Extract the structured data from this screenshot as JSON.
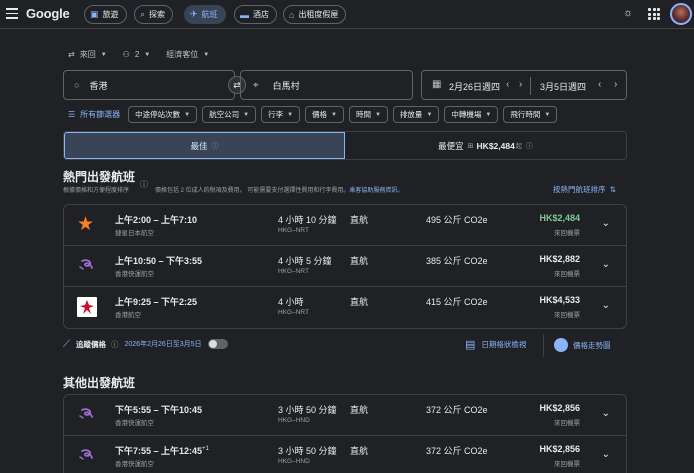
{
  "topbar": {
    "logo": "Google",
    "nav": [
      {
        "label": "旅遊",
        "icon": "travel-icon"
      },
      {
        "label": "探索",
        "icon": "explore-icon"
      },
      {
        "label": "航班",
        "icon": "flight-icon",
        "active": true
      },
      {
        "label": "酒店",
        "icon": "hotel-icon"
      },
      {
        "label": "出租度假屋",
        "icon": "vacation-rental-icon"
      }
    ]
  },
  "search": {
    "trip_type": "來回",
    "passengers": "2",
    "cabin": "經濟客位",
    "origin": "香港",
    "destination": "白馬村",
    "depart_date": "2月26日週四",
    "return_date": "3月5日週四"
  },
  "filters": {
    "all_label": "所有篩選器",
    "chips": [
      "中途停站次數",
      "航空公司",
      "行李",
      "價格",
      "時間",
      "排放量",
      "中轉機場",
      "飛行時間"
    ]
  },
  "sort_tabs": {
    "best": "最佳",
    "cheapest": "最便宜",
    "cheapest_price": "HK$2,484",
    "cheapest_suffix": "起"
  },
  "top_flights": {
    "title": "熱門出發航班",
    "subtitle_left": "根據價格和方便程度排序",
    "subtitle_right": "價格包括 2 位成人的稅項及費用。 可能需要支付選擇性費用和行李費用。",
    "subtitle_link": "乘客協助服務資訊。",
    "sort_label": "按熱門航班排序",
    "rows": [
      {
        "times": "上午2:00 – 上午7:10",
        "sup": "",
        "airline": "捷星日本航空",
        "duration": "4 小時 10 分鐘",
        "route": "HKG–NRT",
        "stops": "直航",
        "co2": "495 公斤 CO2e",
        "price": "HK$2,484",
        "price_type": "來回機票",
        "logo": "jetstar",
        "green": true
      },
      {
        "times": "上午10:50 – 下午3:55",
        "sup": "",
        "airline": "香港快運航空",
        "duration": "4 小時 5 分鐘",
        "route": "HKG–NRT",
        "stops": "直航",
        "co2": "385 公斤 CO2e",
        "price": "HK$2,882",
        "price_type": "來回機票",
        "logo": "hkexpress",
        "green": false
      },
      {
        "times": "上午9:25 – 下午2:25",
        "sup": "",
        "airline": "香港航空",
        "duration": "4 小時",
        "route": "HKG–NRT",
        "stops": "直航",
        "co2": "415 公斤 CO2e",
        "price": "HK$4,533",
        "price_type": "來回機票",
        "logo": "hkairlines",
        "green": false
      }
    ]
  },
  "tracking": {
    "label": "追蹤價格",
    "dates": "2026年2月26日至3月5日",
    "date_grid": "日期格狀檢視",
    "price_graph": "價格走勢圖"
  },
  "other_flights": {
    "title": "其他出發航班",
    "rows": [
      {
        "times": "下午5:55 – 下午10:45",
        "sup": "",
        "airline": "香港快運航空",
        "duration": "3 小時 50 分鐘",
        "route": "HKG–HND",
        "stops": "直航",
        "co2": "372 公斤 CO2e",
        "price": "HK$2,856",
        "price_type": "來回機票",
        "logo": "hkexpress",
        "green": false
      },
      {
        "times": "下午7:55 – 上午12:45",
        "sup": "+1",
        "airline": "香港快運航空",
        "duration": "3 小時 50 分鐘",
        "route": "HKG–HND",
        "stops": "直航",
        "co2": "372 公斤 CO2e",
        "price": "HK$2,856",
        "price_type": "來回機票",
        "logo": "hkexpress",
        "green": false
      }
    ]
  },
  "colors": {
    "accent": "#8ab4f8",
    "price_green": "#81c995",
    "background": "#202124"
  }
}
